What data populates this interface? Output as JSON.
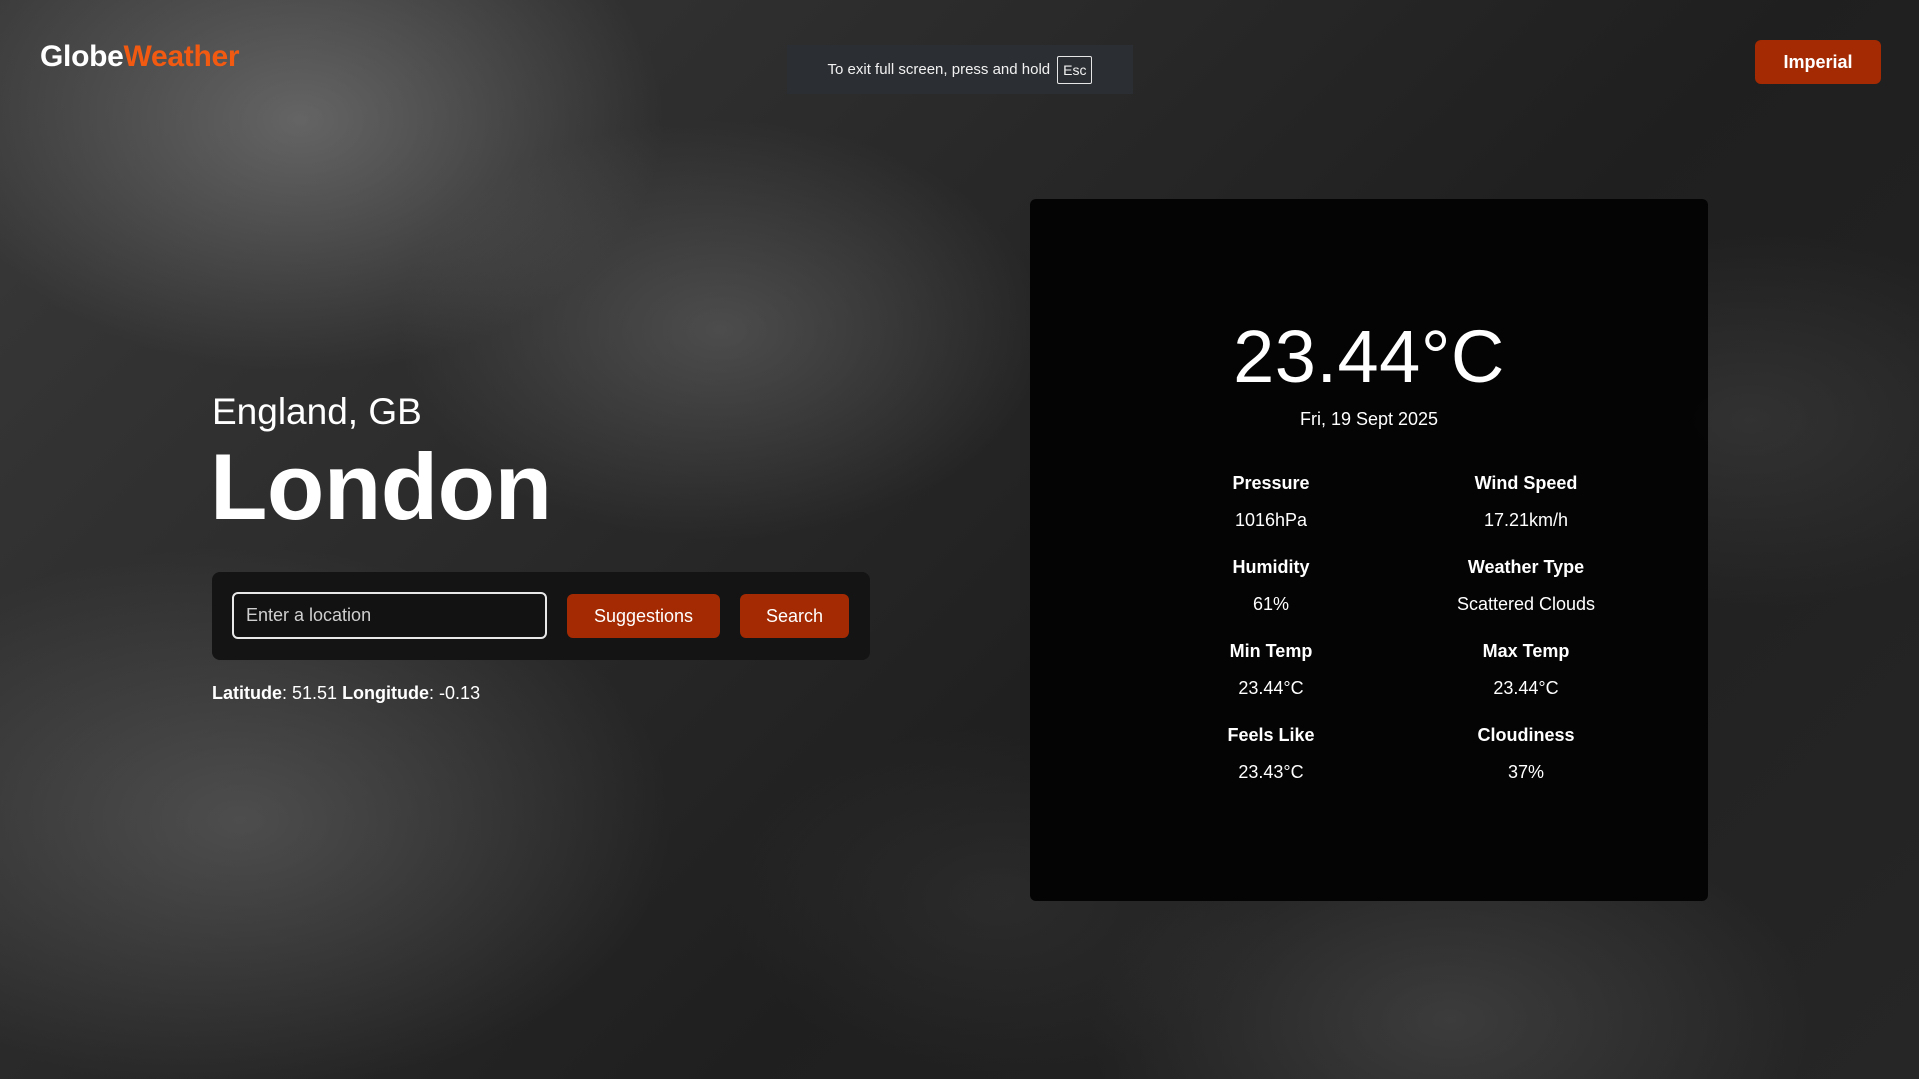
{
  "header": {
    "logo_part_a": "Globe",
    "logo_part_b": "Weather",
    "units_button_label": "Imperial"
  },
  "fullscreen_notice": {
    "text": "To exit full screen, press and hold",
    "key": "Esc"
  },
  "location": {
    "region": "England, GB",
    "city": "London"
  },
  "search": {
    "placeholder": "Enter a location",
    "value": "",
    "suggestions_label": "Suggestions",
    "search_label": "Search"
  },
  "coordinates": {
    "latitude_label": "Latitude",
    "latitude_value": ": 51.51",
    "longitude_label": "Longitude",
    "longitude_value": ": -0.13"
  },
  "weather": {
    "temperature": "23.44°C",
    "date": "Fri, 19 Sept 2025",
    "stats": {
      "pressure": {
        "label": "Pressure",
        "value": "1016hPa"
      },
      "wind_speed": {
        "label": "Wind Speed",
        "value": "17.21km/h"
      },
      "humidity": {
        "label": "Humidity",
        "value": "61%"
      },
      "weather_type": {
        "label": "Weather Type",
        "value": "Scattered Clouds"
      },
      "min_temp": {
        "label": "Min Temp",
        "value": "23.44°C"
      },
      "max_temp": {
        "label": "Max Temp",
        "value": "23.44°C"
      },
      "feels_like": {
        "label": "Feels Like",
        "value": "23.43°C"
      },
      "cloudiness": {
        "label": "Cloudiness",
        "value": "37%"
      }
    }
  },
  "colors": {
    "accent": "#a32a03",
    "logo_accent": "#f25a12",
    "card_background": "#030303"
  }
}
